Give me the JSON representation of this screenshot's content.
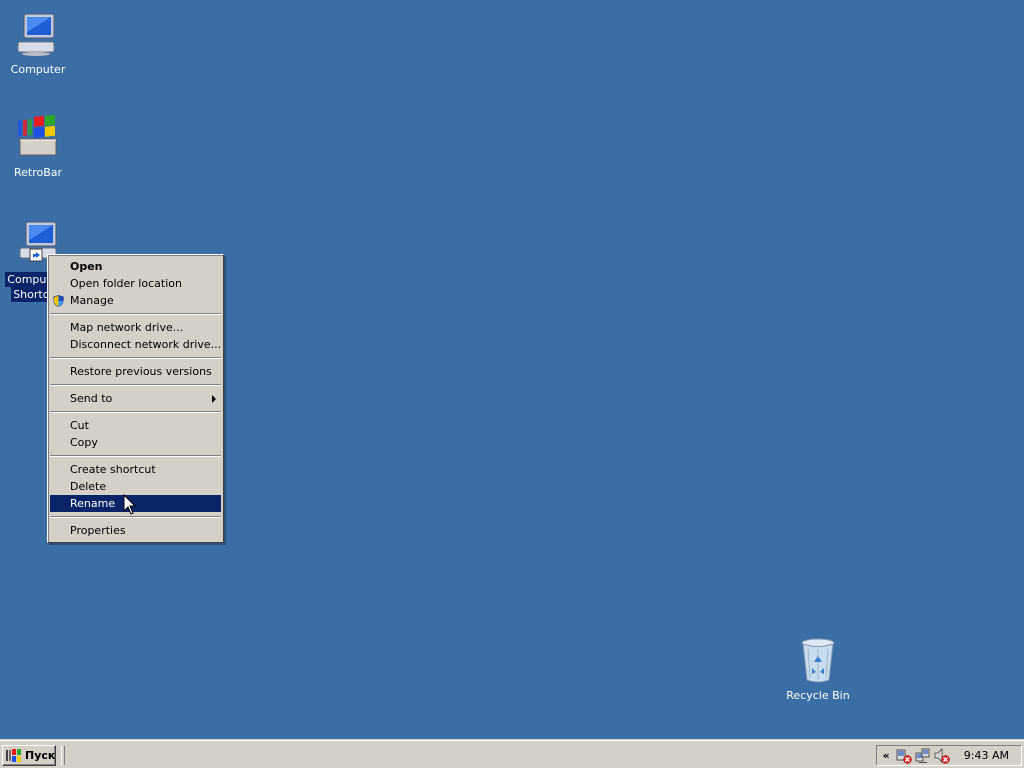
{
  "desktop": {
    "background_color": "#3a6ea5",
    "icons": [
      {
        "label": "Computer",
        "icon": "computer-icon"
      },
      {
        "label": "RetroBar",
        "icon": "retrobar-icon"
      },
      {
        "label": "Computer - Shortcut",
        "visible_label_line1": "Comput",
        "visible_label_line2": "Shortc",
        "icon": "computer-shortcut-icon",
        "selected": true
      },
      {
        "label": "Recycle Bin",
        "icon": "recycle-bin-icon"
      }
    ]
  },
  "context_menu": {
    "items": [
      {
        "label": "Open",
        "bold": true
      },
      {
        "label": "Open folder location"
      },
      {
        "label": "Manage",
        "icon": "uac-shield-icon"
      },
      {
        "label": "Map network drive..."
      },
      {
        "label": "Disconnect network drive..."
      },
      {
        "label": "Restore previous versions"
      },
      {
        "label": "Send to",
        "submenu": true
      },
      {
        "label": "Cut"
      },
      {
        "label": "Copy"
      },
      {
        "label": "Create shortcut"
      },
      {
        "label": "Delete"
      },
      {
        "label": "Rename",
        "highlighted": true
      },
      {
        "label": "Properties"
      }
    ],
    "highlight_color": "#0a246a"
  },
  "taskbar": {
    "start_label": "Пуск",
    "tray_chevron": "«",
    "tray_icons": [
      "network-disconnected-icon",
      "network-icon",
      "volume-muted-icon"
    ],
    "clock": "9:43 AM"
  }
}
